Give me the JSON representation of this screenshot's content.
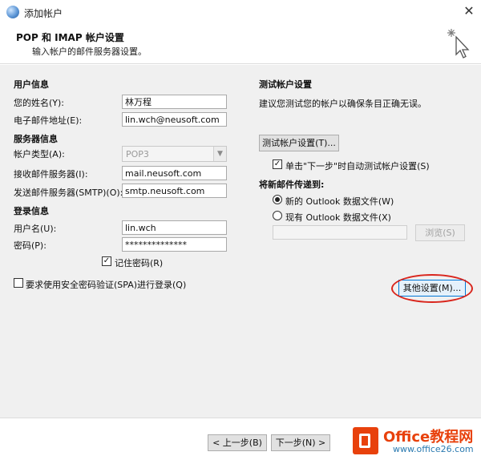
{
  "window": {
    "title": "添加帐户",
    "close_glyph": "✕"
  },
  "header": {
    "title": "POP 和 IMAP 帐户设置",
    "subtitle": "输入帐户的邮件服务器设置。"
  },
  "user_info": {
    "heading": "用户信息",
    "name_label": "您的姓名(Y):",
    "name_value": "林万程",
    "email_label": "电子邮件地址(E):",
    "email_value": "lin.wch@neusoft.com"
  },
  "server_info": {
    "heading": "服务器信息",
    "account_type_label": "帐户类型(A):",
    "account_type_value": "POP3",
    "incoming_label": "接收邮件服务器(I):",
    "incoming_value": "mail.neusoft.com",
    "outgoing_label": "发送邮件服务器(SMTP)(O):",
    "outgoing_value": "smtp.neusoft.com"
  },
  "login_info": {
    "heading": "登录信息",
    "username_label": "用户名(U):",
    "username_value": "lin.wch",
    "password_label": "密码(P):",
    "password_value": "**************",
    "remember_label": "记住密码(R)",
    "remember_checked": true
  },
  "spa": {
    "label": "要求使用安全密码验证(SPA)进行登录(Q)",
    "checked": false
  },
  "test": {
    "heading": "测试帐户设置",
    "description": "建议您测试您的帐户以确保条目正确无误。",
    "button_label": "测试帐户设置(T)...",
    "auto_test_label": "单击\"下一步\"时自动测试帐户设置(S)",
    "auto_test_checked": true
  },
  "deliver": {
    "heading": "将新邮件传递到:",
    "new_file_label": "新的 Outlook 数据文件(W)",
    "existing_file_label": "现有 Outlook 数据文件(X)",
    "selected": "new",
    "path_value": "",
    "browse_label": "浏览(S)"
  },
  "more_settings": {
    "label": "其他设置(M)..."
  },
  "footer": {
    "back_label": "< 上一步(B)",
    "next_label": "下一步(N) >"
  },
  "watermark": {
    "title": "Office教程网",
    "url": "www.office26.com"
  },
  "colors": {
    "accent": "#0078d7",
    "highlight": "#d9251c",
    "brand": "#e8410c"
  },
  "icons": {
    "app": "outlook-globe-icon",
    "wizard": "cursor-sparkle-icon",
    "dropdown": "chevron-down-icon",
    "logo": "office-logo-icon"
  }
}
